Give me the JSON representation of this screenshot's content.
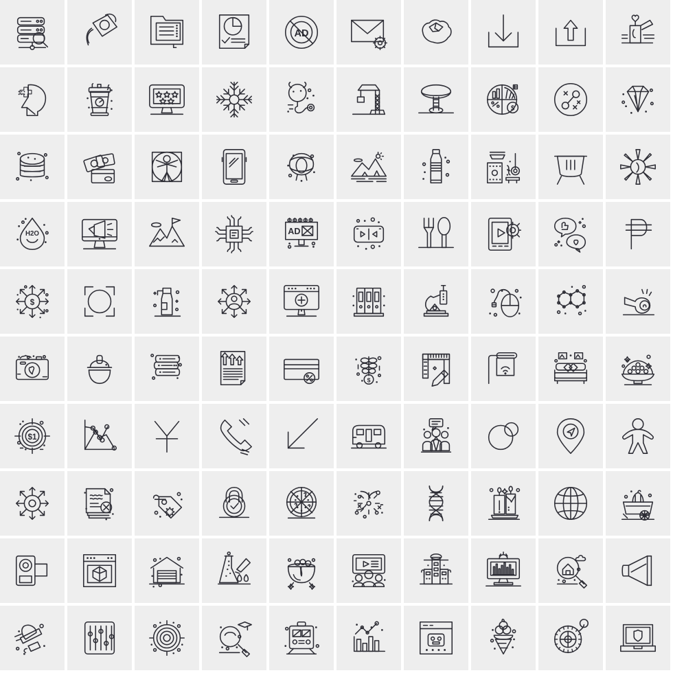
{
  "page": {
    "title": "100 Line Icons Grid",
    "background_color": "#ffffff",
    "tile_color": "#eeeeee",
    "stroke_color": "#2d2d35",
    "columns": 10,
    "rows": 10,
    "total_icons": 100
  },
  "icon_texts": {
    "ad_blocker": "AD",
    "billboard_ad": "AD",
    "water_drop": "H2O",
    "dollar_target": "$1"
  },
  "icons": [
    {
      "id": "r1c1",
      "name": "server-search-icon",
      "label": "Server Search"
    },
    {
      "id": "r1c2",
      "name": "watering-can-icon",
      "label": "Watering Can"
    },
    {
      "id": "r1c3",
      "name": "clipboard-notes-icon",
      "label": "Clipboard Notes"
    },
    {
      "id": "r1c4",
      "name": "pie-chart-document-icon",
      "label": "Pie Chart Document"
    },
    {
      "id": "r1c5",
      "name": "ad-blocker-icon",
      "label": "Ad Blocker"
    },
    {
      "id": "r1c6",
      "name": "mail-settings-icon",
      "label": "Mail Settings"
    },
    {
      "id": "r1c7",
      "name": "australia-map-icon",
      "label": "Australia Map"
    },
    {
      "id": "r1c8",
      "name": "download-icon",
      "label": "Download"
    },
    {
      "id": "r1c9",
      "name": "upload-icon",
      "label": "Upload"
    },
    {
      "id": "r1c10",
      "name": "candle-heart-icon",
      "label": "Heart Candle"
    },
    {
      "id": "r2c1",
      "name": "mental-health-icon",
      "label": "Mental Health"
    },
    {
      "id": "r2c2",
      "name": "coffee-cup-icon",
      "label": "Coffee Cup"
    },
    {
      "id": "r2c3",
      "name": "monitor-rating-icon",
      "label": "Monitor Rating"
    },
    {
      "id": "r2c4",
      "name": "snowflake-icon",
      "label": "Snowflake"
    },
    {
      "id": "r2c5",
      "name": "stethoscope-icon",
      "label": "Stethoscope"
    },
    {
      "id": "r2c6",
      "name": "crane-icon",
      "label": "Construction Crane"
    },
    {
      "id": "r2c7",
      "name": "stool-icon",
      "label": "Stool"
    },
    {
      "id": "r2c8",
      "name": "finance-analytics-icon",
      "label": "Finance Analytics"
    },
    {
      "id": "r2c9",
      "name": "strategy-network-icon",
      "label": "Strategy Network"
    },
    {
      "id": "r2c10",
      "name": "diamond-icon",
      "label": "Diamond"
    },
    {
      "id": "r3c1",
      "name": "coin-stack-icon",
      "label": "Coin Stack"
    },
    {
      "id": "r3c2",
      "name": "cash-card-icon",
      "label": "Cash and Card"
    },
    {
      "id": "r3c3",
      "name": "vitruvian-man-icon",
      "label": "Vitruvian Man"
    },
    {
      "id": "r3c4",
      "name": "smartphone-icon",
      "label": "Smartphone"
    },
    {
      "id": "r3c5",
      "name": "swim-ring-icon",
      "label": "Swim Ring"
    },
    {
      "id": "r3c6",
      "name": "mountain-landscape-icon",
      "label": "Mountain Landscape"
    },
    {
      "id": "r3c7",
      "name": "water-bottle-icon",
      "label": "Water Bottle"
    },
    {
      "id": "r3c8",
      "name": "sauna-heater-icon",
      "label": "Sauna Heater"
    },
    {
      "id": "r3c9",
      "name": "cauldron-icon",
      "label": "Cauldron"
    },
    {
      "id": "r3c10",
      "name": "sun-burst-icon",
      "label": "Sun Burst"
    },
    {
      "id": "r4c1",
      "name": "water-drop-icon",
      "label": "H2O Drop"
    },
    {
      "id": "r4c2",
      "name": "monitor-megaphone-icon",
      "label": "Monitor Megaphone"
    },
    {
      "id": "r4c3",
      "name": "mountain-flag-icon",
      "label": "Mountain Flag"
    },
    {
      "id": "r4c4",
      "name": "processor-chip-icon",
      "label": "Processor Chip"
    },
    {
      "id": "r4c5",
      "name": "billboard-ad-icon",
      "label": "Billboard Ad"
    },
    {
      "id": "r4c6",
      "name": "video-navigation-icon",
      "label": "Video Navigation"
    },
    {
      "id": "r4c7",
      "name": "fork-spoon-icon",
      "label": "Fork and Spoon"
    },
    {
      "id": "r4c8",
      "name": "video-settings-icon",
      "label": "Video Settings"
    },
    {
      "id": "r4c9",
      "name": "social-feedback-icon",
      "label": "Social Feedback"
    },
    {
      "id": "r4c10",
      "name": "peso-currency-icon",
      "label": "Peso Currency"
    },
    {
      "id": "r5c1",
      "name": "money-distribution-icon",
      "label": "Money Distribution"
    },
    {
      "id": "r5c2",
      "name": "focus-frame-icon",
      "label": "Focus Frame"
    },
    {
      "id": "r5c3",
      "name": "spray-bottle-icon",
      "label": "Spray Bottle"
    },
    {
      "id": "r5c4",
      "name": "user-network-icon",
      "label": "User Network"
    },
    {
      "id": "r5c5",
      "name": "monitor-add-icon",
      "label": "Monitor Add"
    },
    {
      "id": "r5c6",
      "name": "binders-icon",
      "label": "Binders"
    },
    {
      "id": "r5c7",
      "name": "microscope-icon",
      "label": "Microscope"
    },
    {
      "id": "r5c8",
      "name": "computer-mouse-icon",
      "label": "Computer Mouse"
    },
    {
      "id": "r5c9",
      "name": "molecule-icon",
      "label": "Molecule"
    },
    {
      "id": "r5c10",
      "name": "whistle-icon",
      "label": "Whistle"
    },
    {
      "id": "r6c1",
      "name": "camera-heart-icon",
      "label": "Camera Heart"
    },
    {
      "id": "r6c2",
      "name": "safety-helmet-icon",
      "label": "Safety Helmet"
    },
    {
      "id": "r6c3",
      "name": "book-stack-icon",
      "label": "Book Stack"
    },
    {
      "id": "r6c4",
      "name": "growth-report-icon",
      "label": "Growth Report"
    },
    {
      "id": "r6c5",
      "name": "discount-card-icon",
      "label": "Discount Card"
    },
    {
      "id": "r6c6",
      "name": "money-plant-icon",
      "label": "Money Plant"
    },
    {
      "id": "r6c7",
      "name": "ruler-pencil-icon",
      "label": "Ruler and Pencil"
    },
    {
      "id": "r6c8",
      "name": "wifi-sign-icon",
      "label": "Wifi Sign"
    },
    {
      "id": "r6c9",
      "name": "bed-icon",
      "label": "Bed"
    },
    {
      "id": "r6c10",
      "name": "sweets-bowl-icon",
      "label": "Sweets Bowl"
    },
    {
      "id": "r7c1",
      "name": "dollar-target-icon",
      "label": "Dollar Target"
    },
    {
      "id": "r7c2",
      "name": "line-chart-icon",
      "label": "Line Chart"
    },
    {
      "id": "r7c3",
      "name": "yen-currency-icon",
      "label": "Yen Currency"
    },
    {
      "id": "r7c4",
      "name": "telephone-icon",
      "label": "Telephone"
    },
    {
      "id": "r7c5",
      "name": "arrow-down-left-icon",
      "label": "Arrow Down Left"
    },
    {
      "id": "r7c6",
      "name": "caravan-icon",
      "label": "Caravan"
    },
    {
      "id": "r7c7",
      "name": "team-meeting-icon",
      "label": "Team Meeting"
    },
    {
      "id": "r7c8",
      "name": "circles-overlap-icon",
      "label": "Overlapping Circles"
    },
    {
      "id": "r7c9",
      "name": "location-pin-icon",
      "label": "Location Pin"
    },
    {
      "id": "r7c10",
      "name": "person-icon",
      "label": "Person"
    },
    {
      "id": "r8c1",
      "name": "ship-helm-icon",
      "label": "Ship Helm"
    },
    {
      "id": "r8c2",
      "name": "document-delete-icon",
      "label": "Document Delete"
    },
    {
      "id": "r8c3",
      "name": "price-tags-icon",
      "label": "Price Tags"
    },
    {
      "id": "r8c4",
      "name": "padlock-verified-icon",
      "label": "Verified Padlock"
    },
    {
      "id": "r8c5",
      "name": "pizza-icon",
      "label": "Pizza"
    },
    {
      "id": "r8c6",
      "name": "firework-icon",
      "label": "Firework"
    },
    {
      "id": "r8c7",
      "name": "dna-icon",
      "label": "DNA"
    },
    {
      "id": "r8c8",
      "name": "candles-icon",
      "label": "Candles"
    },
    {
      "id": "r8c9",
      "name": "globe-icon",
      "label": "Globe"
    },
    {
      "id": "r8c10",
      "name": "harvest-cart-icon",
      "label": "Harvest Cart"
    },
    {
      "id": "r9c1",
      "name": "video-camera-icon",
      "label": "Video Camera"
    },
    {
      "id": "r9c2",
      "name": "browser-3d-icon",
      "label": "Browser 3D Object"
    },
    {
      "id": "r9c3",
      "name": "garage-icon",
      "label": "Garage"
    },
    {
      "id": "r9c4",
      "name": "flask-dropper-icon",
      "label": "Flask and Dropper"
    },
    {
      "id": "r9c5",
      "name": "potion-cauldron-icon",
      "label": "Potion Cauldron"
    },
    {
      "id": "r9c6",
      "name": "video-presentation-icon",
      "label": "Video Presentation"
    },
    {
      "id": "r9c7",
      "name": "city-buildings-icon",
      "label": "City Buildings"
    },
    {
      "id": "r9c8",
      "name": "analytics-monitor-icon",
      "label": "Analytics Monitor"
    },
    {
      "id": "r9c9",
      "name": "house-search-icon",
      "label": "House Search"
    },
    {
      "id": "r9c10",
      "name": "megaphone-icon",
      "label": "Megaphone"
    },
    {
      "id": "r10c1",
      "name": "cleaning-tools-icon",
      "label": "Cleaning Tools"
    },
    {
      "id": "r10c2",
      "name": "equalizer-icon",
      "label": "Equalizer"
    },
    {
      "id": "r10c3",
      "name": "radar-target-icon",
      "label": "Radar Target"
    },
    {
      "id": "r10c4",
      "name": "education-search-icon",
      "label": "Education Search"
    },
    {
      "id": "r10c5",
      "name": "train-icon",
      "label": "Train"
    },
    {
      "id": "r10c6",
      "name": "bar-growth-chart-icon",
      "label": "Bar Growth Chart"
    },
    {
      "id": "r10c7",
      "name": "browser-robot-icon",
      "label": "Browser Robot"
    },
    {
      "id": "r10c8",
      "name": "ice-cream-icon",
      "label": "Ice Cream"
    },
    {
      "id": "r10c9",
      "name": "tape-measure-icon",
      "label": "Tape Measure"
    },
    {
      "id": "r10c10",
      "name": "laptop-security-icon",
      "label": "Laptop Security"
    }
  ]
}
